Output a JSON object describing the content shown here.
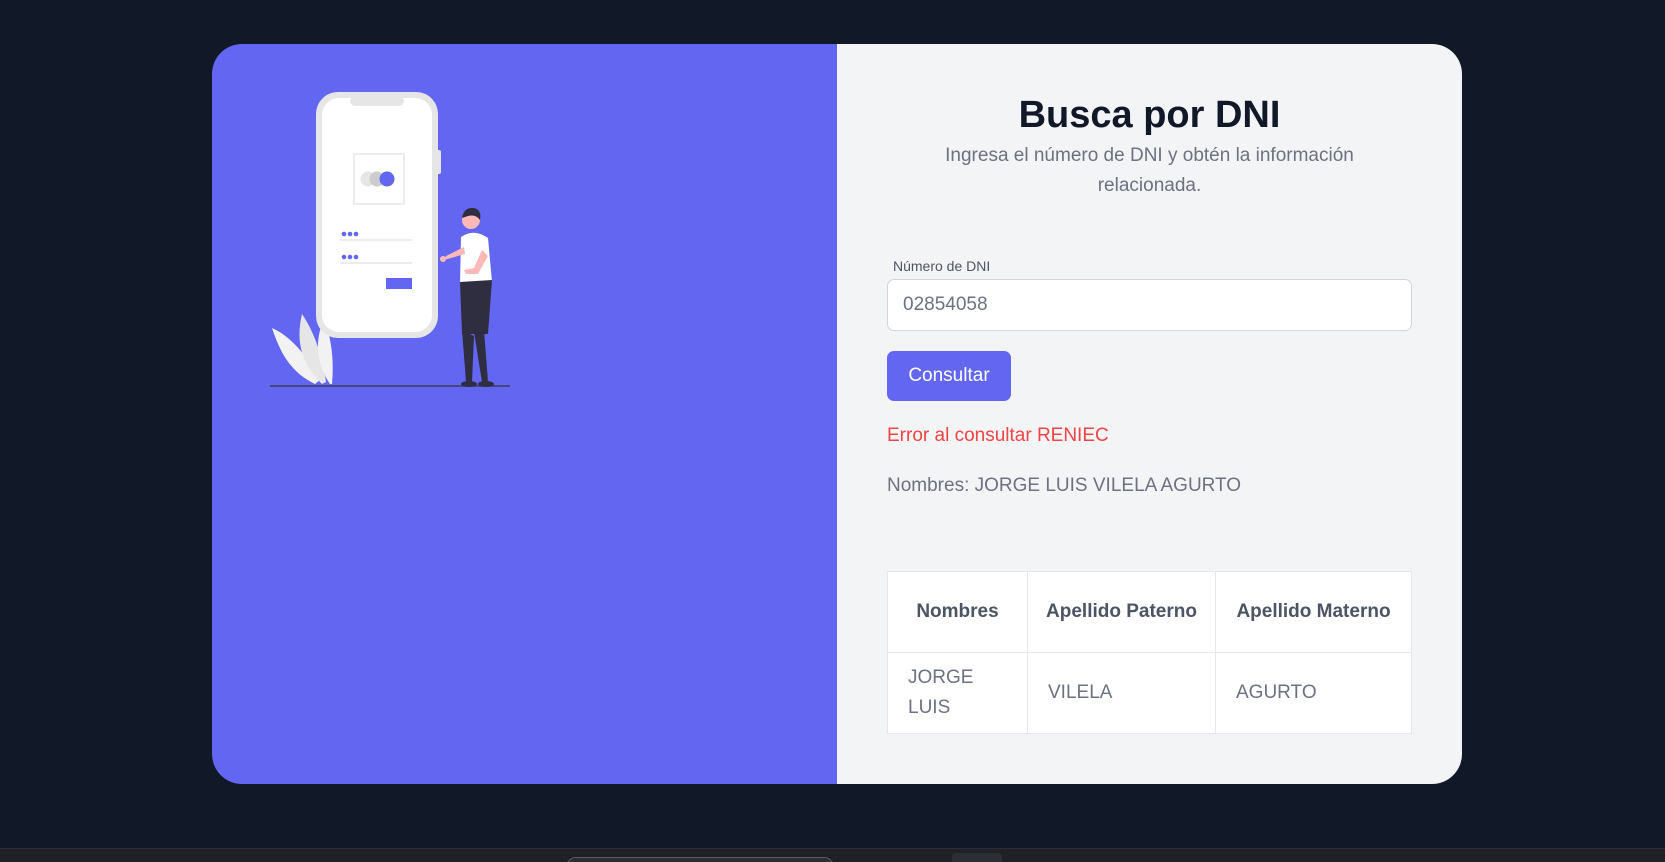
{
  "page": {
    "title": "Busca por DNI",
    "subtitle": "Ingresa el número de DNI y obtén la información relacionada."
  },
  "form": {
    "dni_label": "Número de DNI",
    "dni_value": "02854058",
    "submit_label": "Consultar"
  },
  "messages": {
    "error": "Error al consultar RENIEC",
    "names_summary": "Nombres: JORGE LUIS VILELA AGURTO"
  },
  "table": {
    "headers": [
      "Nombres",
      "Apellido Paterno",
      "Apellido Materno"
    ],
    "rows": [
      [
        "JORGE LUIS",
        "VILELA",
        "AGURTO"
      ]
    ]
  },
  "colors": {
    "accent": "#6366f1",
    "error": "#ef4444",
    "background": "#111827",
    "panel": "#f3f4f6"
  }
}
